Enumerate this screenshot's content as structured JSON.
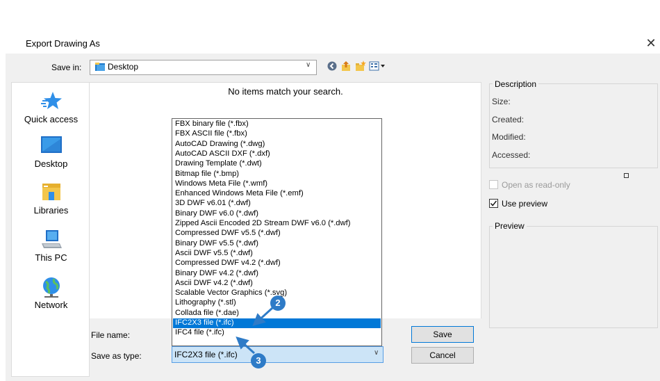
{
  "dialog": {
    "title": "Export Drawing As",
    "close_glyph": "✕"
  },
  "toolbar": {
    "save_in_label": "Save in:",
    "save_in_value": "Desktop",
    "icons": [
      "back-icon",
      "up-folder-icon",
      "new-folder-icon",
      "views-menu-icon"
    ]
  },
  "places": [
    {
      "label": "Quick access",
      "icon": "star-icon"
    },
    {
      "label": "Desktop",
      "icon": "desktop-icon"
    },
    {
      "label": "Libraries",
      "icon": "libraries-icon"
    },
    {
      "label": "This PC",
      "icon": "computer-icon"
    },
    {
      "label": "Network",
      "icon": "network-icon"
    }
  ],
  "file_list": {
    "empty_message": "No items match your search."
  },
  "file_types": [
    "FBX binary file (*.fbx)",
    "FBX ASCII file (*.fbx)",
    "AutoCAD Drawing (*.dwg)",
    "AutoCAD ASCII DXF (*.dxf)",
    "Drawing Template (*.dwt)",
    "Bitmap file (*.bmp)",
    "Windows Meta File (*.wmf)",
    "Enhanced Windows Meta File (*.emf)",
    "3D DWF v6.01 (*.dwf)",
    "Binary DWF v6.0 (*.dwf)",
    "Zipped Ascii Encoded 2D Stream DWF v6.0 (*.dwf)",
    "Compressed DWF v5.5 (*.dwf)",
    "Binary DWF v5.5 (*.dwf)",
    "Ascii DWF v5.5 (*.dwf)",
    "Compressed DWF v4.2 (*.dwf)",
    "Binary DWF v4.2 (*.dwf)",
    "Ascii DWF v4.2 (*.dwf)",
    "Scalable Vector Graphics (*.svg)",
    "Lithography (*.stl)",
    "Collada file (*.dae)",
    "IFC2X3 file (*.ifc)",
    "IFC4 file (*.ifc)"
  ],
  "selected_type_index": 20,
  "bottom": {
    "file_name_label": "File name:",
    "save_as_type_label": "Save as type:",
    "save_as_type_value": "IFC2X3 file (*.ifc)",
    "save_button": "Save",
    "cancel_button": "Cancel"
  },
  "description": {
    "title": "Description",
    "size": "Size:",
    "created": "Created:",
    "modified": "Modified:",
    "accessed": "Accessed:"
  },
  "options": {
    "open_read_only": "Open as read-only",
    "open_read_only_checked": false,
    "open_read_only_enabled": false,
    "use_preview": "Use preview",
    "use_preview_checked": true
  },
  "preview": {
    "title": "Preview"
  },
  "callouts": [
    {
      "number": "2"
    },
    {
      "number": "3"
    }
  ],
  "colors": {
    "selection": "#0078d7",
    "callout": "#2e7bc7",
    "dialog_bg": "#f0f0f0"
  }
}
